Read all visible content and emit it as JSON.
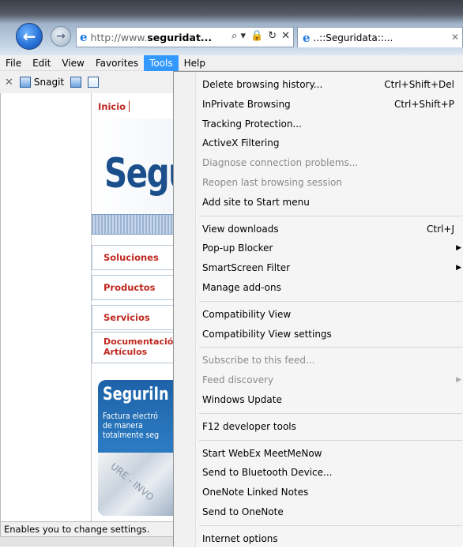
{
  "browser": {
    "address_prefix": "http://www.",
    "address_domain": "seguridat...",
    "address_tools": [
      "⌕ ▾",
      "🔒",
      "↻",
      "✕"
    ],
    "tab_title": "..::Seguridata::..."
  },
  "menubar": [
    {
      "label": "File"
    },
    {
      "label": "Edit"
    },
    {
      "label": "View"
    },
    {
      "label": "Favorites"
    },
    {
      "label": "Tools"
    },
    {
      "label": "Help"
    }
  ],
  "toolbar": {
    "snagit_label": "Snagit"
  },
  "page": {
    "inicio": "Inicio",
    "logo": "Segu",
    "nav": [
      "Soluciones",
      "Productos",
      "Servicios",
      "Documentació",
      "Artículos"
    ],
    "promo_title": "SeguriIn",
    "promo_sub": "Factura electró\nde manera\ntotalmente seg",
    "promo_photo_text": "URE - INVO"
  },
  "status": "Enables you to change settings.",
  "tools_menu": {
    "items": [
      {
        "label": "Delete browsing history...",
        "shortcut": "Ctrl+Shift+Del"
      },
      {
        "label": "InPrivate Browsing",
        "shortcut": "Ctrl+Shift+P"
      },
      {
        "label": "Tracking Protection..."
      },
      {
        "label": "ActiveX Filtering"
      },
      {
        "label": "Diagnose connection problems..."
      },
      {
        "label": "Reopen last browsing session"
      },
      {
        "label": "Add site to Start menu"
      },
      {
        "label": "View downloads",
        "shortcut": "Ctrl+J"
      },
      {
        "label": "Pop-up Blocker"
      },
      {
        "label": "SmartScreen Filter"
      },
      {
        "label": "Manage add-ons"
      },
      {
        "label": "Compatibility View"
      },
      {
        "label": "Compatibility View settings"
      },
      {
        "label": "Subscribe to this feed..."
      },
      {
        "label": "Feed discovery"
      },
      {
        "label": "Windows Update"
      },
      {
        "label": "F12 developer tools"
      },
      {
        "label": "Start WebEx MeetMeNow"
      },
      {
        "label": "Send to Bluetooth Device..."
      },
      {
        "label": "OneNote Linked Notes"
      },
      {
        "label": "Send to OneNote"
      },
      {
        "label": "Internet options"
      }
    ]
  }
}
